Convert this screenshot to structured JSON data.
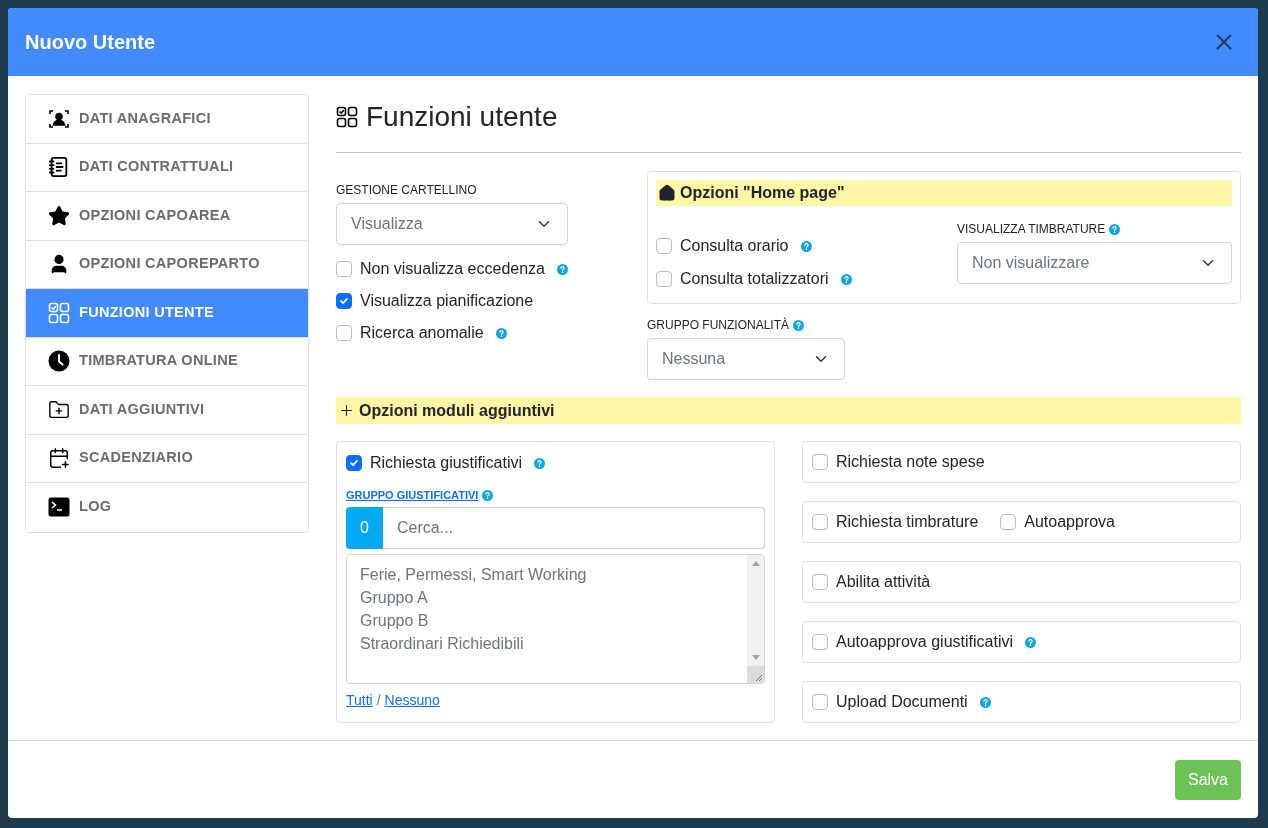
{
  "window": {
    "title": "Nuovo Utente"
  },
  "sidebar": {
    "items": [
      {
        "label": "DATI ANAGRAFICI",
        "kind": "personal",
        "selected": false
      },
      {
        "label": "DATI CONTRATTUALI",
        "kind": "contract",
        "selected": false
      },
      {
        "label": "OPZIONI CAPOAREA",
        "kind": "area",
        "selected": false
      },
      {
        "label": "OPZIONI CAPOREPARTO",
        "kind": "department",
        "selected": false
      },
      {
        "label": "FUNZIONI UTENTE",
        "kind": "functions",
        "selected": true
      },
      {
        "label": "TIMBRATURA ONLINE",
        "kind": "clocking",
        "selected": false
      },
      {
        "label": "DATI AGGIUNTIVI",
        "kind": "extra",
        "selected": false
      },
      {
        "label": "SCADENZIARIO",
        "kind": "deadlines",
        "selected": false
      },
      {
        "label": "LOG",
        "kind": "log",
        "selected": false
      }
    ]
  },
  "section": {
    "title": "Funzioni utente"
  },
  "gestione_cartellino": {
    "label": "GESTIONE CARTELLINO",
    "value": "Visualizza"
  },
  "options": [
    {
      "label": "Non visualizza eccedenza",
      "checked": false,
      "help": true
    },
    {
      "label": "Visualizza pianificazione",
      "checked": true,
      "help": false
    },
    {
      "label": "Ricerca anomalie",
      "checked": false,
      "help": true
    }
  ],
  "home_page": {
    "title": "Opzioni \"Home page\"",
    "options": [
      {
        "label": "Consulta orario",
        "checked": false,
        "help": true
      },
      {
        "label": "Consulta totalizzatori",
        "checked": false,
        "help": true
      }
    ],
    "visualizza_timbrature": {
      "label": "VISUALIZZA TIMBRATURE",
      "help": true,
      "value": "Non visualizzare"
    }
  },
  "gruppo_funzionalita": {
    "label": "GRUPPO FUNZIONALITÀ",
    "help": true,
    "value": "Nessuna"
  },
  "moduli": {
    "title": "Opzioni moduli aggiuntivi",
    "giustificativi": {
      "option": {
        "label": "Richiesta giustificativi",
        "checked": true,
        "help": true
      },
      "group_label": "GRUPPO GIUSTIFICATIVI",
      "group_help": true,
      "count": "0",
      "placeholder": "Cerca...",
      "items": [
        "Ferie, Permessi, Smart Working",
        "Gruppo A",
        "Gruppo B",
        "Straordinari Richiedibili"
      ],
      "select_all": "Tutti",
      "separator": "/",
      "select_none": "Nessuno"
    },
    "cards": [
      {
        "options": [
          {
            "label": "Richiesta note spese",
            "checked": false,
            "help": false
          }
        ]
      },
      {
        "options": [
          {
            "label": "Richiesta timbrature",
            "checked": false,
            "help": false
          },
          {
            "label": "Autoapprova",
            "checked": false,
            "help": false
          }
        ]
      },
      {
        "options": [
          {
            "label": "Abilita attività",
            "checked": false,
            "help": false
          }
        ]
      },
      {
        "options": [
          {
            "label": "Autoapprova giustificativi",
            "checked": false,
            "help": true
          }
        ]
      },
      {
        "options": [
          {
            "label": "Upload Documenti",
            "checked": false,
            "help": true
          }
        ]
      }
    ]
  },
  "footer": {
    "save": "Salva"
  }
}
